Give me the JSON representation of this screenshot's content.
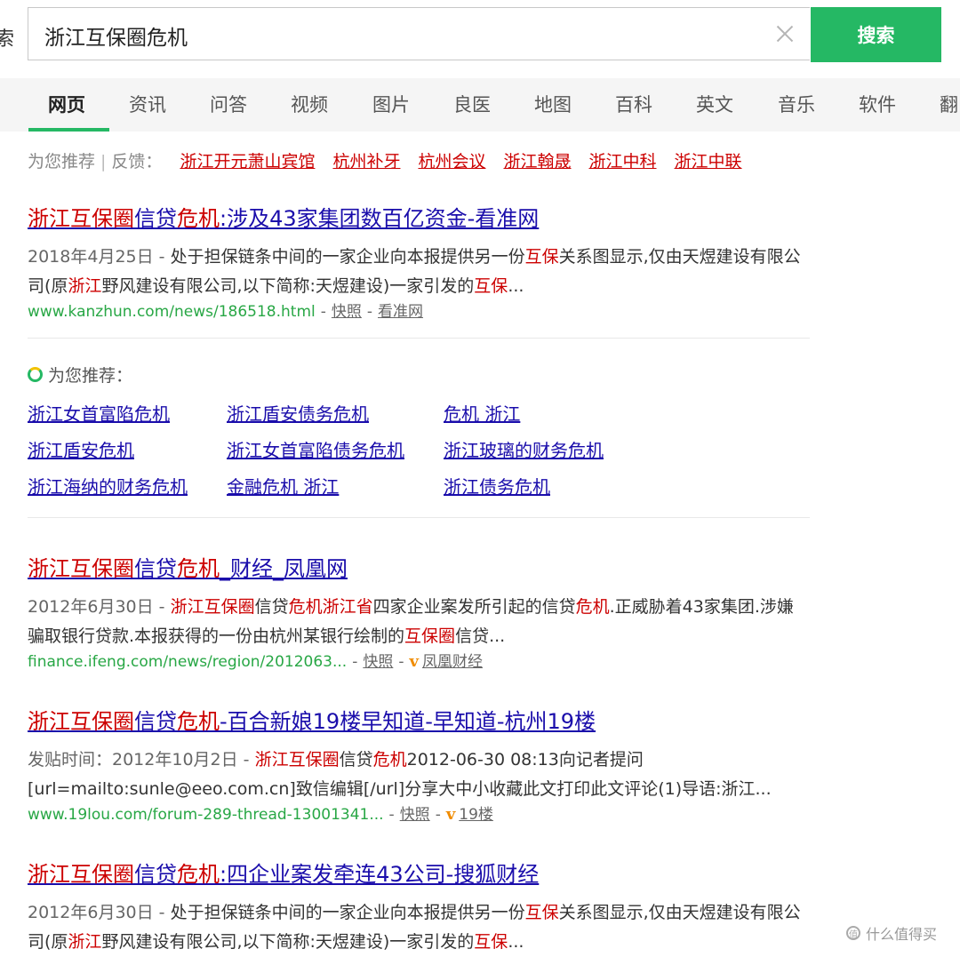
{
  "header": {
    "left_partial": "索",
    "query": "浙江互保圈危机",
    "search_button": "搜索"
  },
  "tabs": [
    "网页",
    "资讯",
    "问答",
    "视频",
    "图片",
    "良医",
    "地图",
    "百科",
    "英文",
    "音乐",
    "软件",
    "翻"
  ],
  "recommend": {
    "label": "为您推荐",
    "sep": "|",
    "feedback": "反馈：",
    "links": [
      "浙江开元萧山宾馆",
      "杭州补牙",
      "杭州会议",
      "浙江翰晟",
      "浙江中科",
      "浙江中联"
    ]
  },
  "results": [
    {
      "title": [
        [
          "浙江互保圈",
          true
        ],
        [
          "信贷",
          false
        ],
        [
          "危机",
          true
        ],
        [
          ":涉及43家集团数百亿资金-看准网",
          false
        ]
      ],
      "snippet": [
        [
          "2018年4月25日 - ",
          "date"
        ],
        [
          "处于担保链条中间的一家企业向本报提供另一份",
          ""
        ],
        [
          "互保",
          "hl"
        ],
        [
          "关系图显示,仅由天煜建设有限公司(原",
          ""
        ],
        [
          "浙江",
          "hl"
        ],
        [
          "野风建设有限公司,以下简称:天煜建设)一家引发的",
          ""
        ],
        [
          "互保",
          "hl"
        ],
        [
          "...",
          ""
        ]
      ],
      "url": "www.kanzhun.com/news/186518.html",
      "kuaizhao": "快照",
      "has_v": false,
      "source": "看准网"
    },
    {
      "title": [
        [
          "浙江互保圈",
          true
        ],
        [
          "信贷",
          false
        ],
        [
          "危机",
          true
        ],
        [
          "_财经_凤凰网",
          false
        ]
      ],
      "snippet": [
        [
          "2012年6月30日 - ",
          "date"
        ],
        [
          "浙江互保圈",
          "hl"
        ],
        [
          "信贷",
          ""
        ],
        [
          "危机浙江省",
          "hl"
        ],
        [
          "四家企业案发所引起的信贷",
          ""
        ],
        [
          "危机",
          "hl"
        ],
        [
          ".正威胁着43家集团.涉嫌骗取银行贷款.本报获得的一份由杭州某银行绘制的",
          ""
        ],
        [
          "互保圈",
          "hl"
        ],
        [
          "信贷...",
          ""
        ]
      ],
      "url": "finance.ifeng.com/news/region/2012063...",
      "kuaizhao": "快照",
      "has_v": true,
      "source": "凤凰财经"
    },
    {
      "title": [
        [
          "浙江互保圈",
          true
        ],
        [
          "信贷",
          false
        ],
        [
          "危机",
          true
        ],
        [
          "-百合新娘19楼早知道-早知道-杭州19楼",
          false
        ]
      ],
      "snippet": [
        [
          "发贴时间：2012年10月2日 - ",
          "date"
        ],
        [
          "浙江互保圈",
          "hl"
        ],
        [
          "信贷",
          ""
        ],
        [
          "危机",
          "hl"
        ],
        [
          "2012-06-30 08:13向记者提问 [url=mailto:sunle@eeo.com.cn]致信编辑[/url]分享大中小收藏此文打印此文评论(1)导语:浙江...",
          ""
        ]
      ],
      "url": "www.19lou.com/forum-289-thread-13001341...",
      "kuaizhao": "快照",
      "has_v": true,
      "source": "19楼"
    },
    {
      "title": [
        [
          "浙江互保圈",
          true
        ],
        [
          "信贷",
          false
        ],
        [
          "危机",
          true
        ],
        [
          ":四企业案发牵连43公司-搜狐财经",
          false
        ]
      ],
      "snippet": [
        [
          "2012年6月30日 - ",
          "date"
        ],
        [
          "处于担保链条中间的一家企业向本报提供另一份",
          ""
        ],
        [
          "互保",
          "hl"
        ],
        [
          "关系图显示,仅由天煜建设有限公司(原",
          ""
        ],
        [
          "浙江",
          "hl"
        ],
        [
          "野风建设有限公司,以下简称:天煜建设)一家引发的",
          ""
        ],
        [
          "互保",
          "hl"
        ],
        [
          "...",
          ""
        ]
      ],
      "url": "",
      "kuaizhao": "",
      "has_v": false,
      "source": ""
    }
  ],
  "related": {
    "label": "为您推荐：",
    "links": [
      "浙江女首富陷危机",
      "浙江盾安债务危机",
      "危机 浙江",
      "浙江盾安危机",
      "浙江女首富陷债务危机",
      "浙江玻璃的财务危机",
      "浙江海纳的财务危机",
      "金融危机 浙江",
      "浙江债务危机"
    ]
  },
  "watermark": "什么值得买",
  "colors": {
    "accent": "#25b864",
    "highlight": "#cc0000",
    "link": "#1a0dab",
    "url": "#28a745"
  }
}
